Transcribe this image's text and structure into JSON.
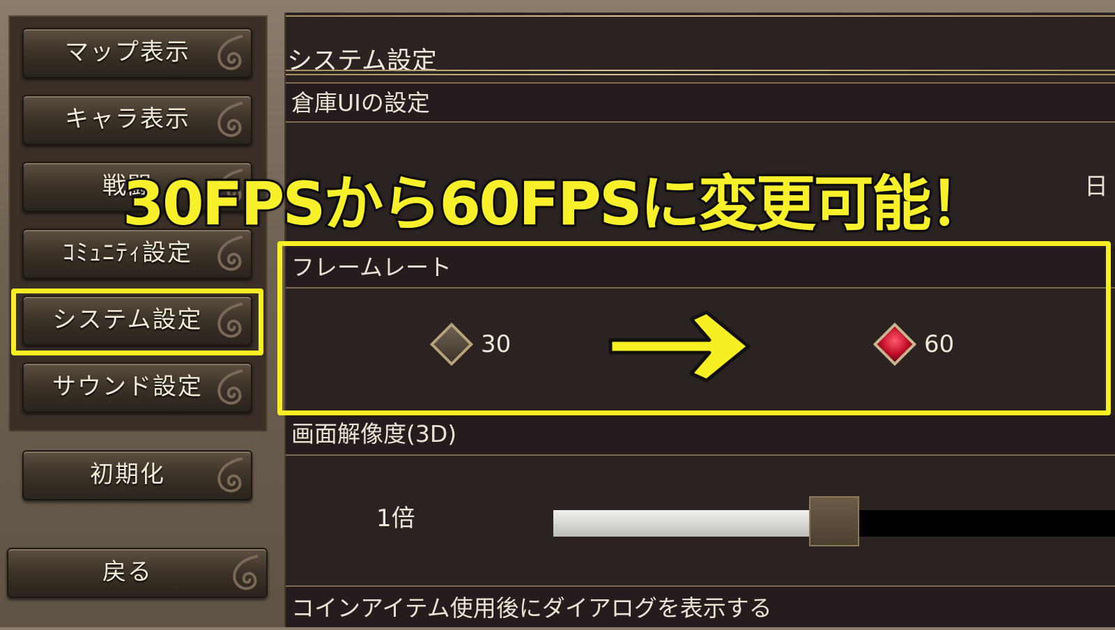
{
  "sidebar": {
    "items": [
      {
        "label": "マップ表示"
      },
      {
        "label": "キャラ表示"
      },
      {
        "label": "戦闘"
      },
      {
        "label": "ｺﾐｭﾆﾃｨ設定"
      },
      {
        "label": "システム設定",
        "selected": true
      },
      {
        "label": "サウンド設定"
      }
    ],
    "reset_label": "初期化",
    "back_label": "戻る"
  },
  "page": {
    "title": "システム設定"
  },
  "sections": {
    "warehouse_ui": "倉庫UIの設定",
    "obscured_option_fragment": "日",
    "frame_rate": {
      "title": "フレームレート",
      "options": [
        {
          "label": "30",
          "selected": false
        },
        {
          "label": "60",
          "selected": true
        }
      ]
    },
    "resolution": {
      "title": "画面解像度(3D)",
      "value_label": "1倍",
      "level": 0.5
    },
    "coin_item": "コインアイテム使用後にダイアログを表示する"
  },
  "overlay": {
    "banner": "30FPSから60FPSに変更可能！"
  },
  "colors": {
    "highlight": "#f7ef22",
    "selected_gem": "#c4102a",
    "panel_bg": "#2b2222"
  },
  "icons": {
    "button_ornament": "swirl-ornament-icon",
    "radio": "diamond-gem-icon",
    "arrow": "right-arrow-icon"
  }
}
